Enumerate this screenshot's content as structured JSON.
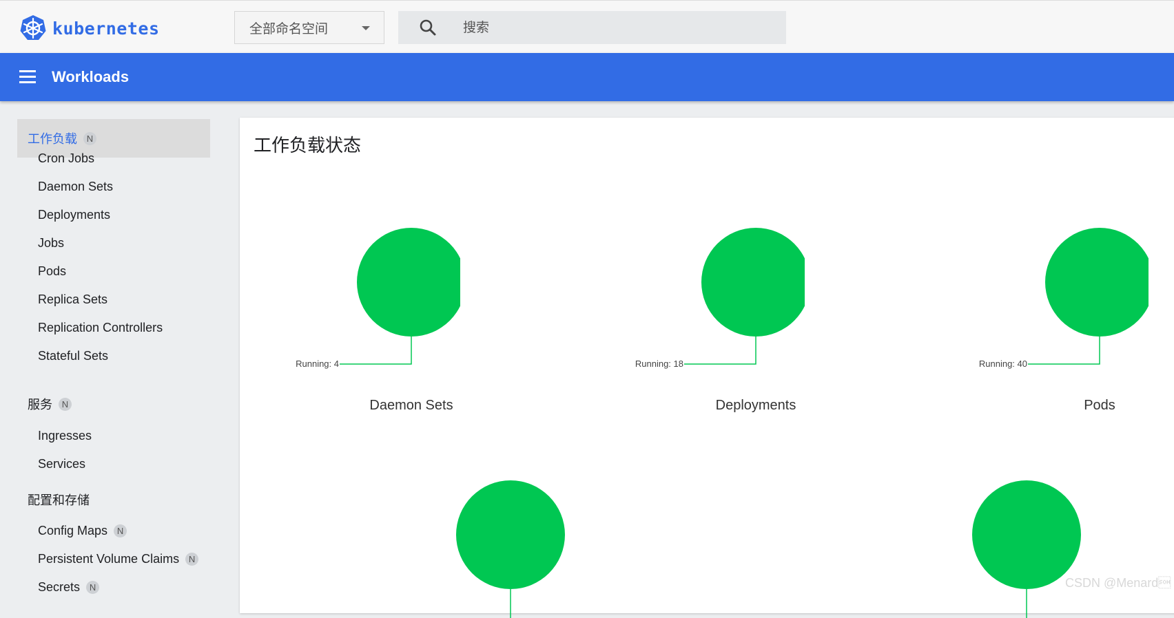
{
  "brand": {
    "name": "kubernetes"
  },
  "namespace_selector": {
    "value": "全部命名空间"
  },
  "search": {
    "placeholder": "搜索"
  },
  "header": {
    "title": "Workloads"
  },
  "sidebar": {
    "sections": [
      {
        "label": "工作负载",
        "badge": "N",
        "items": [
          {
            "label": "Cron Jobs"
          },
          {
            "label": "Daemon Sets"
          },
          {
            "label": "Deployments"
          },
          {
            "label": "Jobs"
          },
          {
            "label": "Pods"
          },
          {
            "label": "Replica Sets"
          },
          {
            "label": "Replication Controllers"
          },
          {
            "label": "Stateful Sets"
          }
        ]
      },
      {
        "label": "服务",
        "badge": "N",
        "items": [
          {
            "label": "Ingresses"
          },
          {
            "label": "Services"
          }
        ]
      },
      {
        "label": "配置和存储",
        "items": [
          {
            "label": "Config Maps",
            "badge": "N"
          },
          {
            "label": "Persistent Volume Claims",
            "badge": "N"
          },
          {
            "label": "Secrets",
            "badge": "N"
          }
        ]
      }
    ]
  },
  "main": {
    "title": "工作负载状态",
    "charts": [
      {
        "name": "Daemon Sets",
        "running_label": "Running: 4",
        "running": 4
      },
      {
        "name": "Deployments",
        "running_label": "Running: 18",
        "running": 18
      },
      {
        "name": "Pods",
        "running_label": "Running: 40",
        "running": 40
      }
    ]
  },
  "colors": {
    "accent": "#326ce5",
    "running": "#00c752"
  },
  "watermark": "CSDN @Menard\u0001"
}
